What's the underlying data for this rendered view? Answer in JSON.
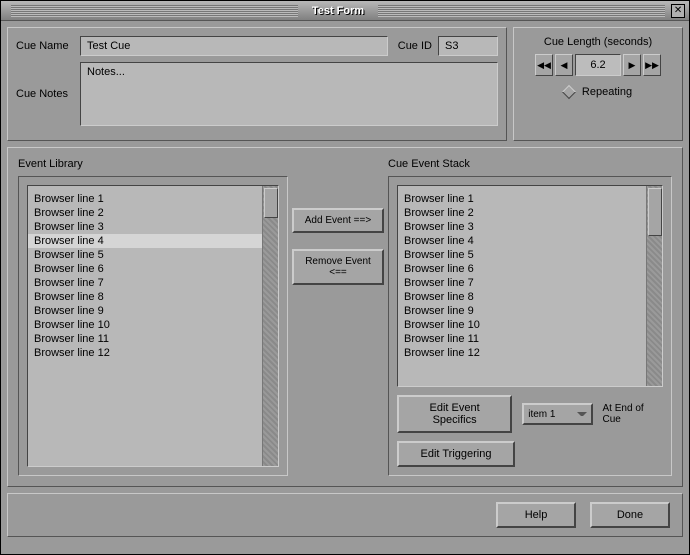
{
  "window": {
    "title": "Test Form"
  },
  "header": {
    "cue_name_label": "Cue Name",
    "cue_name_value": "Test Cue",
    "cue_id_label": "Cue ID",
    "cue_id_value": "S3",
    "cue_notes_label": "Cue Notes",
    "cue_notes_value": "Notes...",
    "cue_length_label": "Cue Length (seconds)",
    "cue_length_value": "6.2",
    "repeating_label": "Repeating"
  },
  "mid": {
    "library_label": "Event Library",
    "stack_label": "Cue Event Stack",
    "add_event_label": "Add Event ==>",
    "remove_event_label": "Remove Event <==",
    "edit_specifics_label": "Edit Event Specifics",
    "edit_triggering_label": "Edit Triggering",
    "dropdown_value": "item 1",
    "end_of_cue_label": "At End of Cue"
  },
  "library_items": [
    {
      "label": "Browser line 1"
    },
    {
      "label": "Browser line 2"
    },
    {
      "label": "Browser line 3"
    },
    {
      "label": "Browser line 4"
    },
    {
      "label": "Browser line 5"
    },
    {
      "label": "Browser line 6"
    },
    {
      "label": "Browser line 7"
    },
    {
      "label": "Browser line 8"
    },
    {
      "label": "Browser line 9"
    },
    {
      "label": "Browser line 10"
    },
    {
      "label": "Browser line 11"
    },
    {
      "label": "Browser line 12"
    }
  ],
  "library_selected_index": 3,
  "stack_items": [
    {
      "label": "Browser line 1"
    },
    {
      "label": "Browser line 2"
    },
    {
      "label": "Browser line 3"
    },
    {
      "label": "Browser line 4"
    },
    {
      "label": "Browser line 5"
    },
    {
      "label": "Browser line 6"
    },
    {
      "label": "Browser line 7"
    },
    {
      "label": "Browser line 8"
    },
    {
      "label": "Browser line 9"
    },
    {
      "label": "Browser line 10"
    },
    {
      "label": "Browser line 11"
    },
    {
      "label": "Browser line 12"
    }
  ],
  "footer": {
    "help_label": "Help",
    "done_label": "Done"
  }
}
